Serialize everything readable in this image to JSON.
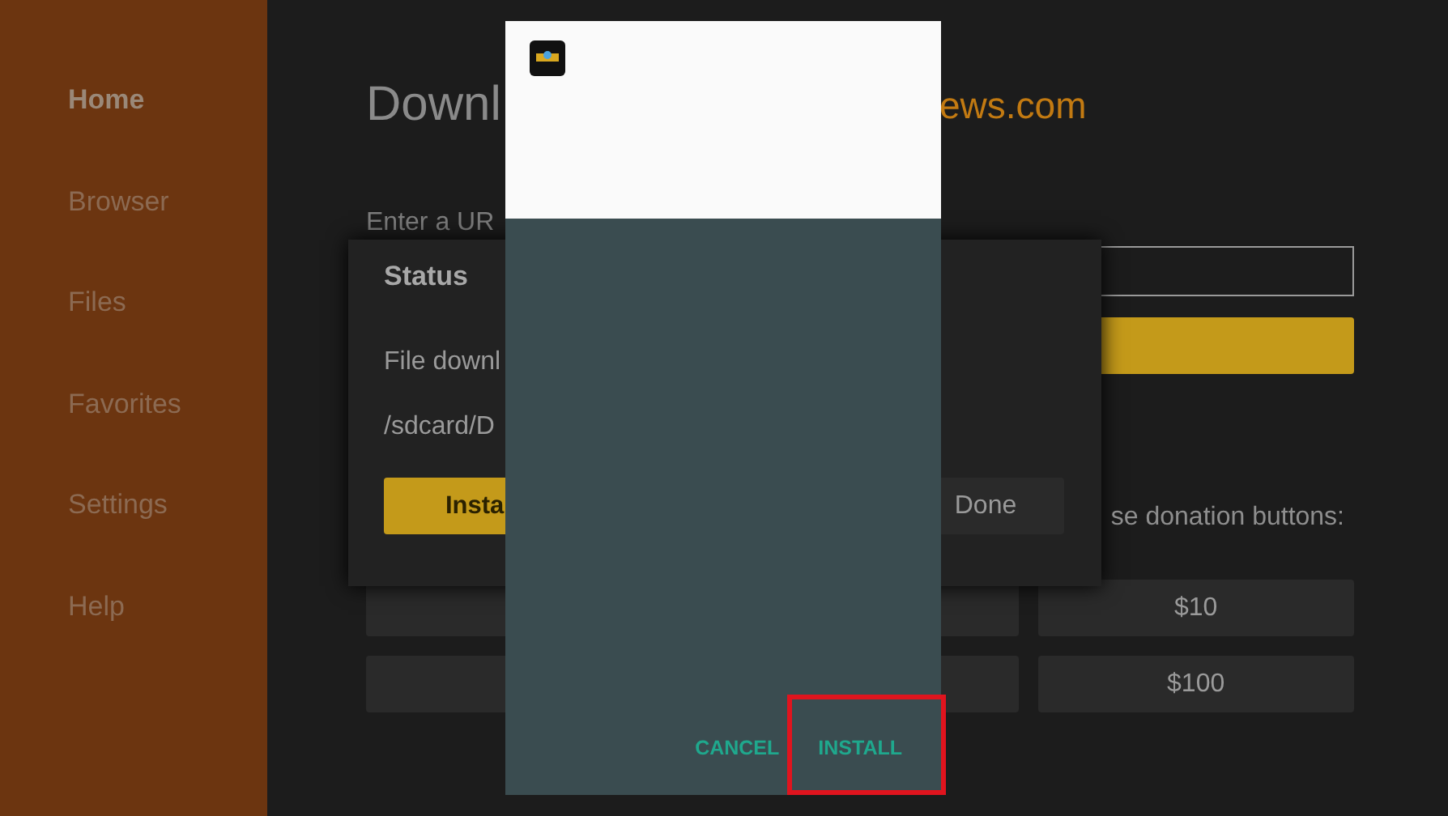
{
  "sidebar": {
    "items": [
      {
        "label": "Home",
        "selected": true
      },
      {
        "label": "Browser",
        "selected": false
      },
      {
        "label": "Files",
        "selected": false
      },
      {
        "label": "Favorites",
        "selected": false
      },
      {
        "label": "Settings",
        "selected": false
      },
      {
        "label": "Help",
        "selected": false
      }
    ]
  },
  "page": {
    "title": "Downl",
    "title_link": "ews.com",
    "url_label": "Enter a UR",
    "donation_text": "se donation buttons:",
    "donation_buttons": [
      {
        "label": "$10"
      },
      {
        "label": "$100"
      }
    ]
  },
  "status_dialog": {
    "title": "Status",
    "message": "File downl",
    "path": "/sdcard/D",
    "buttons": [
      {
        "label": "Insta",
        "kind": "primary"
      },
      {
        "label": "Done",
        "kind": "secondary"
      }
    ]
  },
  "install_dialog": {
    "buttons": [
      {
        "label": "CANCEL",
        "highlighted": false
      },
      {
        "label": "INSTALL",
        "highlighted": true
      }
    ]
  }
}
